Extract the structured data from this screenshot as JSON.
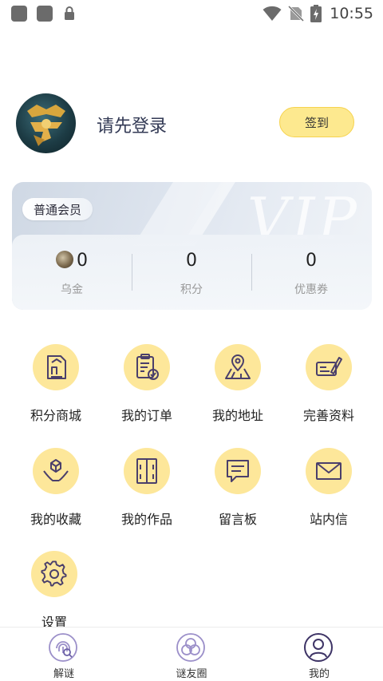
{
  "status_bar": {
    "time": "10:55"
  },
  "profile": {
    "login_prompt": "请先登录",
    "signin_label": "签到"
  },
  "vip_card": {
    "member_level": "普通会员",
    "watermark": "VIP",
    "stats": [
      {
        "value": "0",
        "label": "乌金"
      },
      {
        "value": "0",
        "label": "积分"
      },
      {
        "value": "0",
        "label": "优惠券"
      }
    ]
  },
  "grid": [
    {
      "label": "积分商城",
      "icon": "points-mall-icon"
    },
    {
      "label": "我的订单",
      "icon": "orders-icon"
    },
    {
      "label": "我的地址",
      "icon": "address-icon"
    },
    {
      "label": "完善资料",
      "icon": "edit-profile-icon"
    },
    {
      "label": "我的收藏",
      "icon": "favorites-icon"
    },
    {
      "label": "我的作品",
      "icon": "works-icon"
    },
    {
      "label": "留言板",
      "icon": "message-board-icon"
    },
    {
      "label": "站内信",
      "icon": "mail-icon"
    },
    {
      "label": "设置",
      "icon": "settings-icon"
    }
  ],
  "bottom_nav": [
    {
      "label": "解谜",
      "icon": "fingerprint-icon",
      "active": false
    },
    {
      "label": "谜友圈",
      "icon": "circles-icon",
      "active": false
    },
    {
      "label": "我的",
      "icon": "profile-icon",
      "active": true
    }
  ],
  "colors": {
    "accent_yellow": "#fde79a",
    "icon_stroke": "#4a3f6b",
    "nav_purple": "#9b8fc9"
  }
}
